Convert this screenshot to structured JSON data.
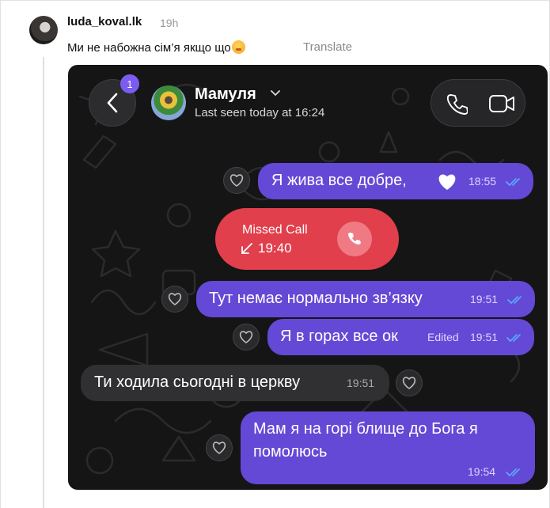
{
  "post": {
    "username": "luda_koval.lk",
    "time": "19h",
    "text": "Ми не набожна сім’я якщо що",
    "translate_label": "Translate"
  },
  "chat": {
    "unread_count": "1",
    "contact_name": "Мамуля",
    "status": "Last seen today at 16:24",
    "missed_call": {
      "title": "Missed Call",
      "time": "19:40"
    },
    "messages": [
      {
        "text": "Я жива все добре,",
        "time": "18:55",
        "direction": "out"
      },
      {
        "text": "Тут немає нормально зв’язку",
        "time": "19:51",
        "direction": "out"
      },
      {
        "text": "Я в горах все ок",
        "edited": "Edited",
        "time": "19:51",
        "direction": "out"
      },
      {
        "text": "Ти ходила сьогодні в церкву",
        "time": "19:51",
        "direction": "in"
      },
      {
        "line1": "Мам я на горі блище до Бога я",
        "line2": "помолюсь",
        "time": "19:54",
        "direction": "out"
      }
    ]
  },
  "colors": {
    "outgoing_bubble": "#6449d6",
    "incoming_bubble": "#303033",
    "missed_call": "#e13f4c",
    "badge": "#7c5cf0"
  }
}
